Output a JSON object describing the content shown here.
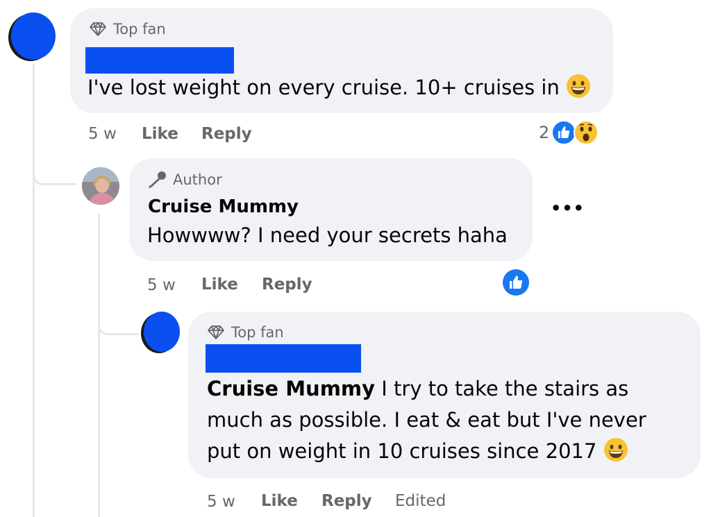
{
  "comments": [
    {
      "badge": "Top fan",
      "text": "I've lost weight on every cruise. 10+ cruises in",
      "time": "5 w",
      "like_label": "Like",
      "reply_label": "Reply",
      "reaction_count": "2",
      "reactions": [
        "like-icon",
        "wow-icon"
      ]
    },
    {
      "badge": "Author",
      "author": "Cruise Mummy",
      "text": "Howwww? I need your secrets haha",
      "time": "5 w",
      "like_label": "Like",
      "reply_label": "Reply",
      "reactions": [
        "like-icon"
      ]
    },
    {
      "badge": "Top fan",
      "mention": "Cruise Mummy",
      "text_line1": " I try to take the stairs as",
      "text_line2": "much as possible. I eat & eat but I've never",
      "text_line3": "put on weight in 10 cruises since 2017",
      "time": "5 w",
      "like_label": "Like",
      "reply_label": "Reply",
      "edited_label": "Edited"
    }
  ],
  "more_options": "•••",
  "colors": {
    "redaction_blue": "#0a4ff0",
    "bubble_gray": "#f0f2f5",
    "like_blue": "#1877f2",
    "meta_gray": "#65676b"
  }
}
